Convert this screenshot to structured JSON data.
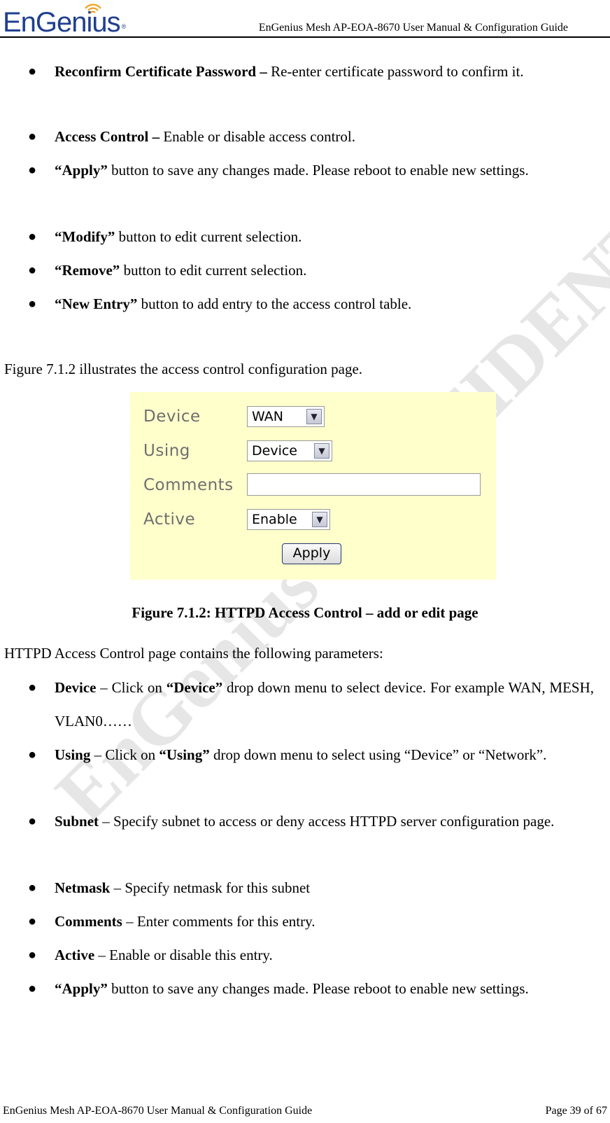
{
  "header": {
    "logo_text": "EnGenius",
    "logo_reg": "®",
    "title": "EnGenius Mesh AP-EOA-8670 User Manual & Configuration Guide"
  },
  "top_bullets": [
    {
      "bold": "Reconfirm Certificate Password –",
      "text": " Re-enter certificate password to confirm it."
    },
    {
      "bold": "Access Control –",
      "text": " Enable or disable access control."
    },
    {
      "bold": "“Apply”",
      "text": " button to save any changes made. Please reboot to enable new settings."
    },
    {
      "bold": "“Modify”",
      "text": " button to edit current selection."
    },
    {
      "bold": "“Remove”",
      "text": " button to edit current selection."
    },
    {
      "bold": "“New Entry”",
      "text": " button to add entry to the access control table."
    }
  ],
  "intro": "Figure 7.1.2 illustrates the access control configuration page.",
  "figure": {
    "device_label": "Device",
    "device_value": "WAN",
    "using_label": "Using",
    "using_value": "Device",
    "comments_label": "Comments",
    "comments_value": "",
    "active_label": "Active",
    "active_value": "Enable",
    "apply_label": "Apply",
    "dropdown_icon": "chevron-down-icon"
  },
  "caption": "Figure 7.1.2: HTTPD Access Control – add or edit page",
  "params_intro": "HTTPD Access Control page contains the following parameters:",
  "bottom_bullets": [
    {
      "bold": "Device",
      "text": " – Click on ",
      "bold2": "“Device”",
      "text2": " drop down menu to select device. For example WAN, MESH, VLAN0……"
    },
    {
      "bold": "Using",
      "text": " – Click on ",
      "bold2": "“Using”",
      "text2": " drop down menu to select using “Device” or “Network”."
    },
    {
      "bold": "Subnet",
      "text": " – Specify subnet to access or deny access HTTPD server configuration page.",
      "bold2": "",
      "text2": ""
    },
    {
      "bold": "Netmask",
      "text": " – Specify netmask for this subnet",
      "bold2": "",
      "text2": ""
    },
    {
      "bold": "Comments",
      "text": " – Enter comments for this entry.",
      "bold2": "",
      "text2": ""
    },
    {
      "bold": "Active",
      "text": " – Enable or disable this entry.",
      "bold2": "",
      "text2": ""
    },
    {
      "bold": "“Apply”",
      "text": " button to save any changes made. Please reboot to enable new settings.",
      "bold2": "",
      "text2": ""
    }
  ],
  "watermark": "EnGenius CONFIDENTIAL",
  "footer": {
    "left": "EnGenius Mesh AP-EOA-8670 User Manual & Configuration Guide",
    "right": "Page 39 of 67"
  }
}
